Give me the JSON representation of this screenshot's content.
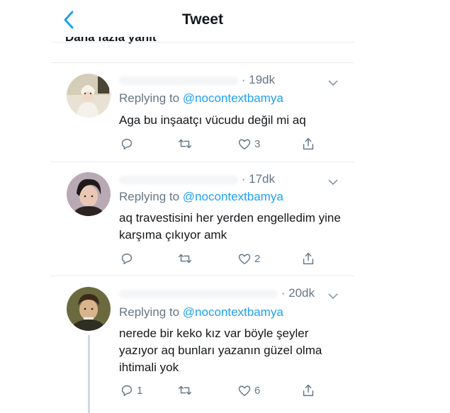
{
  "header": {
    "title": "Tweet",
    "section_label": "Daha fazla yanıt"
  },
  "colors": {
    "accent": "#1da1f2",
    "secondary_text": "#657786",
    "primary_text": "#14171a",
    "divider": "#e6ecf0"
  },
  "tweets": [
    {
      "time": "· 19dk",
      "replying_prefix": "Replying to",
      "mention": "@nocontextbamya",
      "text": "Aga bu inşaatçı vücudu değil mi aq",
      "counts": {
        "reply": "",
        "retweet": "",
        "like": "3"
      }
    },
    {
      "time": "· 17dk",
      "replying_prefix": "Replying to",
      "mention": "@nocontextbamya",
      "text": "aq travestisini her yerden engelledim yine karşıma çıkıyor amk",
      "counts": {
        "reply": "",
        "retweet": "",
        "like": "2"
      }
    },
    {
      "time": "· 20dk",
      "replying_prefix": "Replying to",
      "mention": "@nocontextbamya",
      "text": "nerede bir keko kız var böyle şeyler yazıyor aq bunları yazanın güzel olma ihtimali yok",
      "counts": {
        "reply": "1",
        "retweet": "",
        "like": "6"
      }
    }
  ],
  "icons": [
    "back-chevron-icon",
    "chevron-down-icon",
    "reply-icon",
    "retweet-icon",
    "like-icon",
    "share-icon"
  ]
}
